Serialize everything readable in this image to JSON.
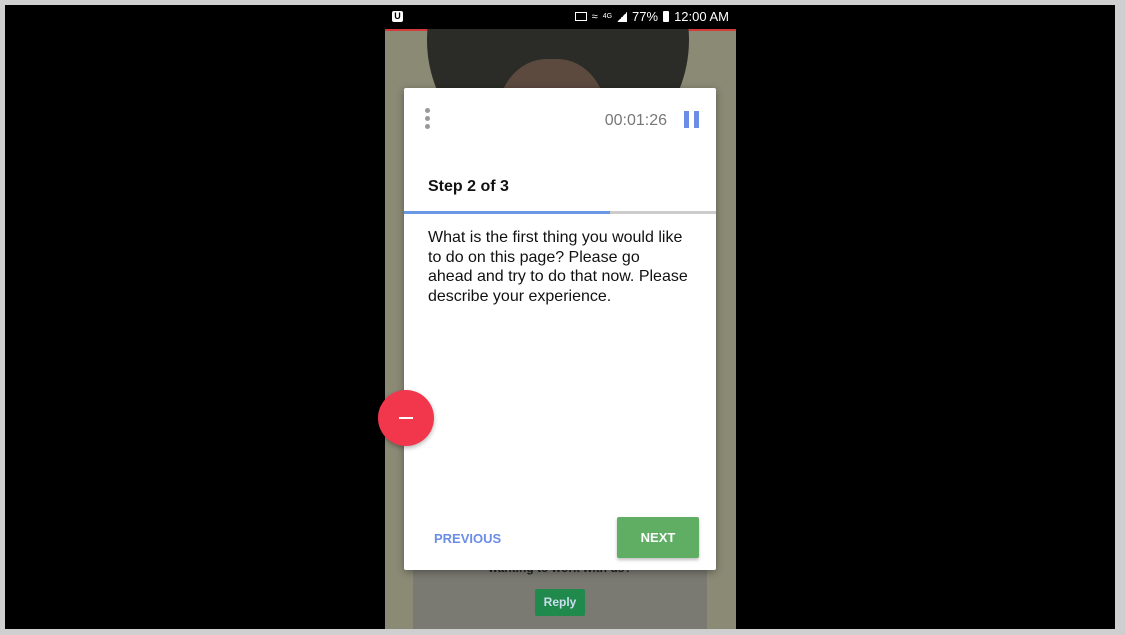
{
  "status_bar": {
    "left_icon_label": "U",
    "network_label": "4G",
    "battery_percent": "77%",
    "time": "12:00 AM"
  },
  "background_app": {
    "card_text": "wanting to work with us?",
    "reply_label": "Reply"
  },
  "task_modal": {
    "timer": "00:01:26",
    "step_label": "Step 2 of 3",
    "progress_fraction": 0.66,
    "question": "What is the first thing you would like to do on this page? Please go ahead and try to do that now. Please describe your experience.",
    "previous_label": "PREVIOUS",
    "next_label": "NEXT"
  },
  "colors": {
    "accent_blue": "#6b8de6",
    "next_green": "#5fae64",
    "fab_red": "#f2374d"
  }
}
